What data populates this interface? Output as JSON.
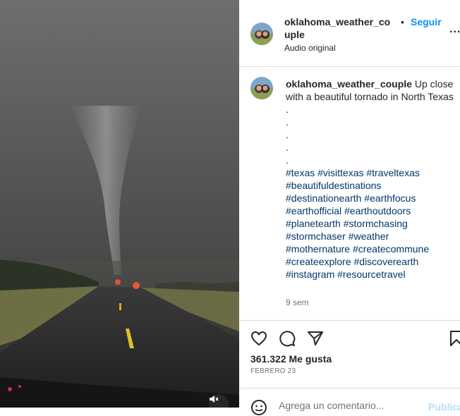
{
  "header": {
    "username": "oklahoma_weather_couple",
    "separator": "•",
    "follow_label": "Seguir",
    "more_label": "...",
    "subtitle": "Audio original"
  },
  "caption": {
    "username": "oklahoma_weather_couple",
    "text": "Up close with a beautiful tornado in North Texas",
    "dots": [
      ".",
      ".",
      ".",
      ".",
      "."
    ],
    "hashtags": [
      "#texas #visittexas #traveltexas",
      "#beautifuldestinations",
      "#destinationearth #earthfocus",
      "#earthofficial #earthoutdoors",
      "#planetearth #stormchasing",
      "#stormchaser #weather",
      "#mothernature #createcommune",
      "#createexplore #discoverearth",
      "#instagram #resourcetravel"
    ],
    "age": "9 sem"
  },
  "stats": {
    "likes": "361.322 Me gusta",
    "date": "FEBRERO 23"
  },
  "comment": {
    "placeholder": "Agrega un comentario...",
    "post_label": "Publicar"
  },
  "icons": {
    "like": "heart-icon",
    "comment": "comment-icon",
    "share": "send-icon",
    "save": "bookmark-icon",
    "mute": "speaker-muted-icon",
    "emoji": "emoji-icon"
  },
  "colors": {
    "follow": "#0095f6",
    "hashtag": "#00376b",
    "muted_text": "#737373",
    "border": "#dbdbdb"
  }
}
